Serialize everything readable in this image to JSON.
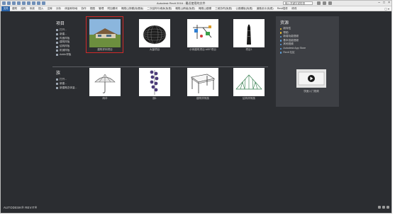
{
  "window": {
    "title": "Autodesk Revit 2016 - 最近使用的文件",
    "search_placeholder": "输入关键字或短语"
  },
  "ribbon": {
    "tabs": [
      "文件",
      "建筑",
      "结构",
      "系统",
      "插入",
      "注释",
      "分析",
      "体量和场地",
      "协作",
      "视图",
      "管理",
      "附加模块",
      "橄榄山快模(免费版)",
      "二次结构与墙身(免费)",
      "橄榄山精装(免费)",
      "橄榄山建模",
      "三维协同(免费)",
      "公路模板(免费)",
      "道路设计(免费)",
      "Revit插件",
      "修改"
    ],
    "active_tab": "文件",
    "end_control": "▢ ▾"
  },
  "projects": {
    "title": "项目",
    "links": [
      "打开...",
      "新建...",
      "构造样板",
      "建筑样板",
      "结构样板",
      "机械样板",
      "Addin样板"
    ],
    "items": [
      {
        "label": "建筑样例项目",
        "icon": "house-photo"
      },
      {
        "label": "大量项目",
        "icon": "dome-wireframe"
      },
      {
        "label": "示例建筑项目-MEP项目",
        "icon": "mep-piping"
      },
      {
        "label": "项目1",
        "icon": "tower-model"
      }
    ]
  },
  "families": {
    "title": "族",
    "links": [
      "打开...",
      "新建...",
      "新建概念体量..."
    ],
    "items": [
      {
        "label": "雨伞",
        "icon": "umbrella"
      },
      {
        "label": "族1",
        "icon": "column-of-spheres"
      },
      {
        "label": "建筑样例族",
        "icon": "table"
      },
      {
        "label": "结构样例族",
        "icon": "truss"
      }
    ]
  },
  "resources": {
    "title": "资源",
    "items": [
      {
        "label": "新特性",
        "bullet": "yellow"
      },
      {
        "label": "帮助",
        "bullet": "yellow"
      },
      {
        "label": "新增功能视频",
        "bullet": "blue"
      },
      {
        "label": "基本技能视频",
        "bullet": "blue"
      },
      {
        "label": "其他视频",
        "bullet": "blue"
      },
      {
        "label": "Autodesk App Store",
        "bullet": "blue"
      },
      {
        "label": "Revit 社区",
        "bullet": "blue"
      }
    ],
    "video_label": "快速入门视频"
  },
  "footer": {
    "brand": "AUTODESK® REVIT®"
  },
  "colors": {
    "background": "#2b2d31",
    "accent": "#2a63a8",
    "selection": "#d02a2a",
    "resources_panel": "#3d3f44"
  }
}
